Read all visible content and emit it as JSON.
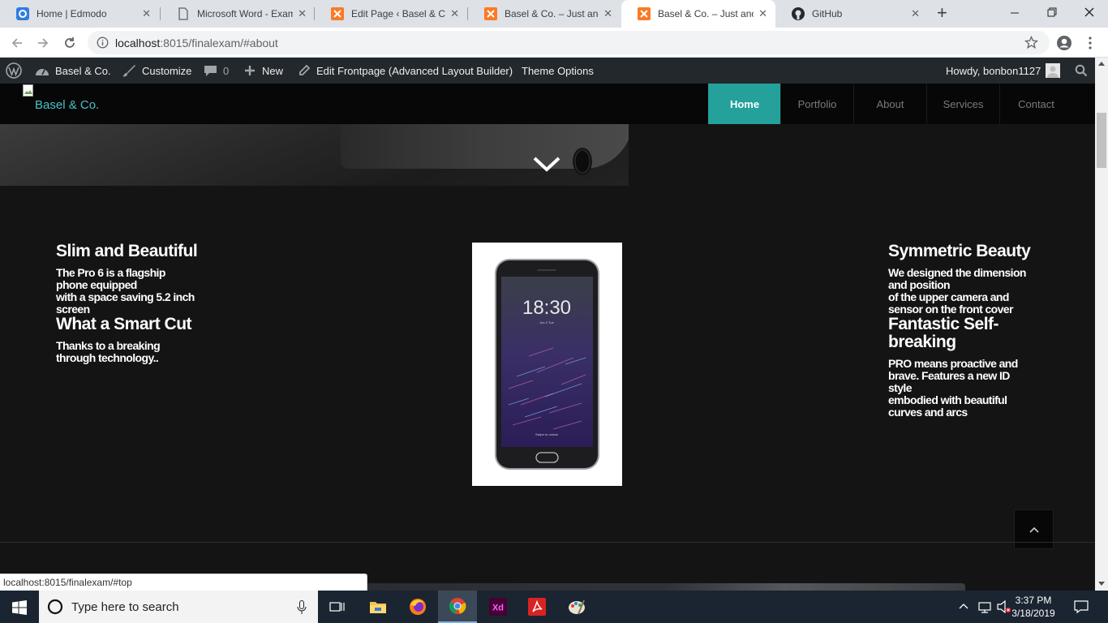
{
  "browser": {
    "tabs": [
      {
        "title": "Home | Edmodo",
        "icon": "edmodo-icon"
      },
      {
        "title": "Microsoft Word - Exam",
        "icon": "document-icon"
      },
      {
        "title": "Edit Page ‹ Basel & Co.",
        "icon": "xampp-icon"
      },
      {
        "title": "Basel & Co. – Just anoth",
        "icon": "xampp-icon"
      },
      {
        "title": "Basel & Co. – Just anoth",
        "icon": "xampp-icon"
      },
      {
        "title": "GitHub",
        "icon": "github-icon"
      }
    ],
    "close_glyph": "✕",
    "new_tab_glyph": "+",
    "url_host": "localhost",
    "url_path": ":8015/finalexam/#about"
  },
  "wp_admin_bar": {
    "site_name": "Basel & Co.",
    "customize": "Customize",
    "comments_count": "0",
    "new_label": "New",
    "edit_frontpage": "Edit Frontpage (Advanced Layout Builder)",
    "theme_options": "Theme Options",
    "howdy": "Howdy, bonbon1127"
  },
  "site": {
    "logo_alt": "Basel & Co.",
    "nav": [
      "Home",
      "Portfolio",
      "About",
      "Services",
      "Contact"
    ]
  },
  "content": {
    "left": {
      "h1": "Slim and Beautiful",
      "p1": [
        "The Pro  6 is a flagship",
        "phone equipped",
        "with a space saving 5.2 inch",
        "screen"
      ],
      "h2": "What a Smart Cut",
      "p2": [
        "Thanks to a breaking",
        "through technology.."
      ]
    },
    "phone": {
      "time": "18:30",
      "date": "Jun 2 Tue",
      "unlock": "Swipe to unlock"
    },
    "right": {
      "h1": "Symmetric Beauty",
      "p1": [
        "We designed the dimension",
        "and position",
        "of the upper camera and",
        "sensor on the front cover"
      ],
      "h2": [
        "Fantastic Self-",
        "breaking"
      ],
      "p2": [
        "PRO means proactive and",
        "brave. Features a new ID",
        "style",
        "embodied with beautiful",
        "curves and arcs"
      ]
    }
  },
  "status_url": "localhost:8015/finalexam/#top",
  "taskbar": {
    "search_placeholder": "Type here to search",
    "time": "3:37 PM",
    "date": "3/18/2019"
  },
  "colors": {
    "accent": "#24a19b",
    "logo_text": "#4ac0c9",
    "page_bg": "#141414"
  }
}
